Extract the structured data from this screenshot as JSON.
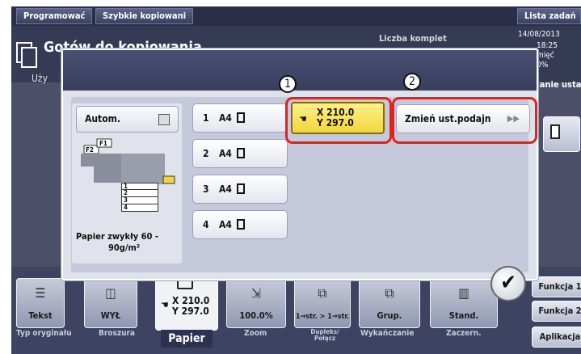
{
  "topbar": {
    "btn1": "Programować",
    "btn2": "Szybkie kopiowani",
    "btn3": "Lista zadań"
  },
  "background": {
    "title": "Gotów do kopiowania",
    "subtitle": "Uży",
    "liczba": "Liczba komplet",
    "date": "14/08/2013",
    "time": "18:25",
    "mem_label": "mięć",
    "mem_value": "0%",
    "zanie": "zanie usta"
  },
  "dialog": {
    "autom_label": "Autom.",
    "trays": [
      {
        "num": "1",
        "size": "A4"
      },
      {
        "num": "2",
        "size": "A4"
      },
      {
        "num": "3",
        "size": "A4"
      },
      {
        "num": "4",
        "size": "A4"
      }
    ],
    "custom_size_line1": "X 210.0",
    "custom_size_line2": "Y 297.0",
    "change_button": "Zmień ust.podajn",
    "paper_type_line1": "Papier zwykły 60 -",
    "paper_type_line2": "90g/m²",
    "tray_diagram_labels": [
      "F2",
      "F1",
      "1",
      "2",
      "3",
      "4"
    ],
    "callouts": [
      "1",
      "2"
    ],
    "ok_icon": "checkmark-icon"
  },
  "funcbar": {
    "tiles": [
      {
        "label": "Tekst",
        "caption": "Typ oryginału"
      },
      {
        "label": "WYŁ",
        "caption": "Broszura"
      },
      {
        "label_line1": "X 210.0",
        "label_line2": "Y 297.0",
        "caption": "Papier"
      },
      {
        "label": "100.0%",
        "caption": "Zoom"
      },
      {
        "label": "1→str. > 1→str.",
        "caption": "Dupleks/ Połącz"
      },
      {
        "label": "Grup.",
        "caption": "Wykańczanie"
      },
      {
        "label": "Stand.",
        "caption": "Zaczern."
      }
    ],
    "side_buttons": [
      "Funkcja 1",
      "Funkcja 2",
      "Aplikacja"
    ]
  }
}
